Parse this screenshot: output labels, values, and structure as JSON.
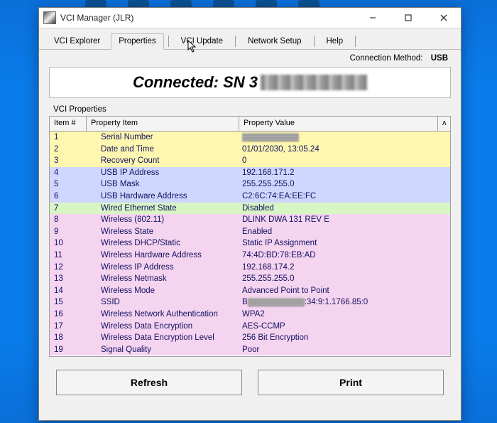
{
  "window": {
    "title": "VCI Manager (JLR)"
  },
  "tabs": {
    "items": [
      "VCI Explorer",
      "Properties",
      "VCI Update",
      "Network Setup",
      "Help"
    ],
    "active": 1
  },
  "connection": {
    "label": "Connection Method:",
    "value": "USB"
  },
  "status": {
    "text": "Connected: SN 3"
  },
  "section": {
    "caption": "VCI Properties"
  },
  "columns": {
    "c1": "Item #",
    "c2": "Property Item",
    "c3": "Property Value",
    "scroll": "ʌ"
  },
  "rows": [
    {
      "n": "1",
      "prop": "Serial Number",
      "val": "",
      "redact": true,
      "cls": "yellow"
    },
    {
      "n": "2",
      "prop": "Date and Time",
      "val": "01/01/2030, 13:05.24",
      "cls": "yellow"
    },
    {
      "n": "3",
      "prop": "Recovery Count",
      "val": "0",
      "cls": "yellow"
    },
    {
      "n": "4",
      "prop": "USB IP Address",
      "val": "192.168.171.2",
      "cls": "blue"
    },
    {
      "n": "5",
      "prop": "USB Mask",
      "val": "255.255.255.0",
      "cls": "blue"
    },
    {
      "n": "6",
      "prop": "USB Hardware Address",
      "val": "C2:6C:74:EA:EE:FC",
      "cls": "blue"
    },
    {
      "n": "7",
      "prop": "Wired Ethernet State",
      "val": "Disabled",
      "cls": "green"
    },
    {
      "n": "8",
      "prop": "Wireless (802.11)",
      "val": "DLINK DWA 131 REV E",
      "cls": "pink"
    },
    {
      "n": "9",
      "prop": "Wireless State",
      "val": "Enabled",
      "cls": "pink"
    },
    {
      "n": "10",
      "prop": "Wireless DHCP/Static",
      "val": "Static IP Assignment",
      "cls": "pink"
    },
    {
      "n": "11",
      "prop": "Wireless Hardware Address",
      "val": "74:4D:BD:78:EB:AD",
      "cls": "pink"
    },
    {
      "n": "12",
      "prop": "Wireless IP Address",
      "val": "192.168.174.2",
      "cls": "pink"
    },
    {
      "n": "13",
      "prop": "Wireless Netmask",
      "val": "255.255.255.0",
      "cls": "pink"
    },
    {
      "n": "14",
      "prop": "Wireless Mode",
      "val": "Advanced Point to Point",
      "cls": "pink"
    },
    {
      "n": "15",
      "prop": "SSID",
      "val": "B",
      "redact": true,
      "valSuffix": ":34:9:1.1766.85:0",
      "cls": "pink"
    },
    {
      "n": "16",
      "prop": "Wireless Network Authentication",
      "val": "WPA2",
      "cls": "pink"
    },
    {
      "n": "17",
      "prop": "Wireless Data Encryption",
      "val": "AES-CCMP",
      "cls": "pink"
    },
    {
      "n": "18",
      "prop": "Wireless Data Encryption Level",
      "val": "256 Bit Encryption",
      "cls": "pink"
    },
    {
      "n": "19",
      "prop": "Signal Quality",
      "val": "Poor",
      "cls": "pink"
    }
  ],
  "buttons": {
    "refresh": "Refresh",
    "print": "Print"
  }
}
